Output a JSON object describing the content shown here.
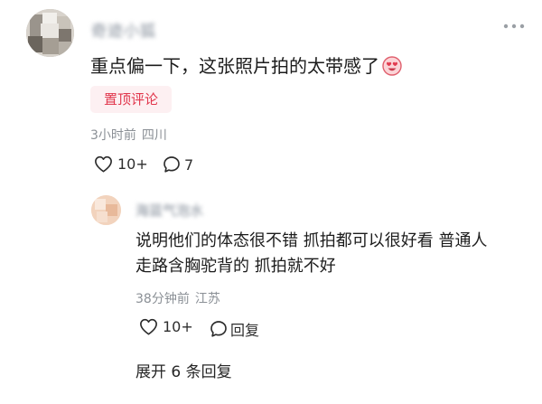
{
  "comment": {
    "username": "奇迹小狐",
    "text": "重点偏一下，这张照片拍的太带感了",
    "emoji_icon": "heart-eyes-emoji",
    "pin_label": "置顶评论",
    "time": "3小时前",
    "location": "四川",
    "like_count": "10+",
    "reply_count": "7"
  },
  "reply": {
    "username": "海蓝气泡水",
    "text_lines": [
      "说明他们的体态很不错 抓拍都可以很好看 普通人",
      "走路含胸驼背的 抓拍就不好"
    ],
    "time": "38分钟前",
    "location": "江苏",
    "like_count": "10+",
    "reply_label": "回复"
  },
  "expand_label": "展开 6 条回复",
  "colors": {
    "pin_text": "#e1364c",
    "pin_bg": "#fdf0f2",
    "meta_text": "#8b9096",
    "body_text": "#1c1c1c"
  }
}
